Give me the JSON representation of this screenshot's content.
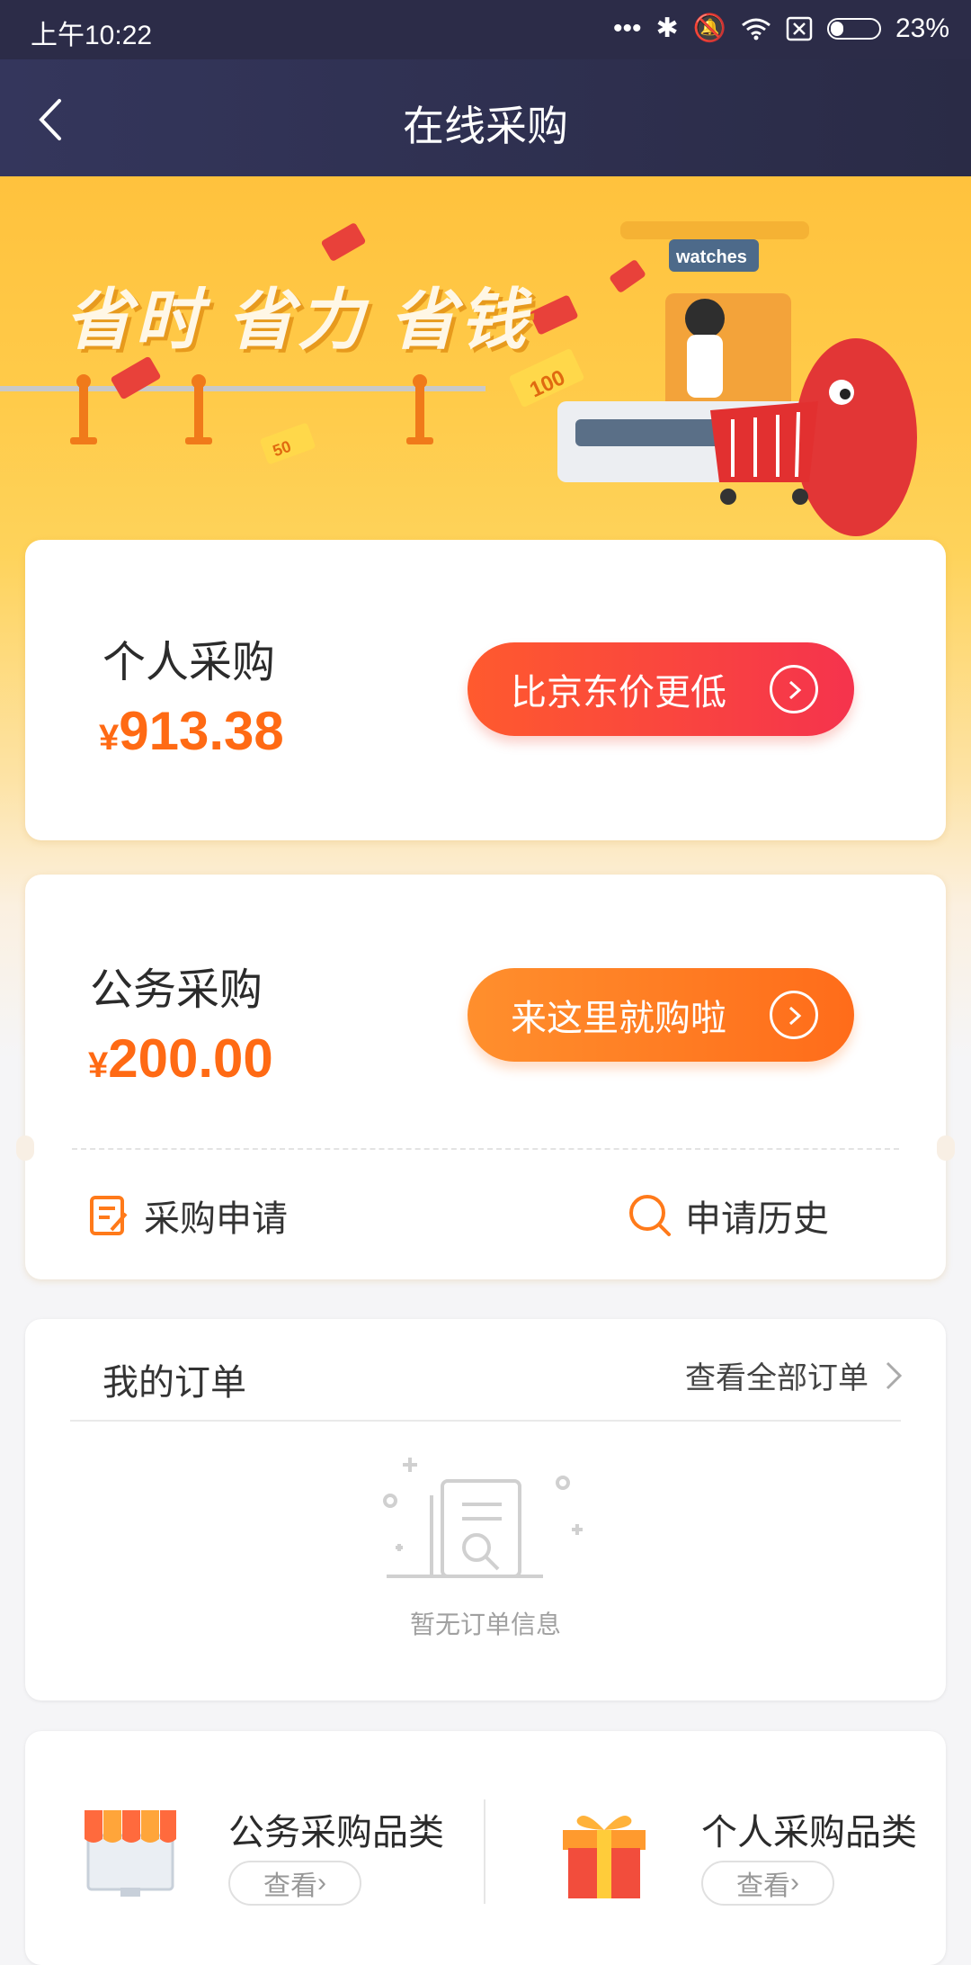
{
  "status_bar": {
    "time": "上午10:22",
    "battery": "23%"
  },
  "header": {
    "title": "在线采购"
  },
  "banner": {
    "slogan": "省时 省力 省钱",
    "sign": "watches",
    "coupon1": "100",
    "coupon2": "50"
  },
  "personal": {
    "title": "个人采购",
    "currency": "¥",
    "amount": "913.38",
    "button": "比京东价更低"
  },
  "business": {
    "title": "公务采购",
    "currency": "¥",
    "amount": "200.00",
    "button": "来这里就购啦",
    "apply": "采购申请",
    "history": "申请历史"
  },
  "orders": {
    "title": "我的订单",
    "view_all": "查看全部订单",
    "empty": "暂无订单信息"
  },
  "categories": [
    {
      "title": "公务采购品类",
      "button": "查看"
    },
    {
      "title": "个人采购品类",
      "button": "查看"
    }
  ],
  "colors": {
    "accent": "#ff6a14",
    "header": "#2c2c48",
    "banner": "#ffc23d"
  }
}
